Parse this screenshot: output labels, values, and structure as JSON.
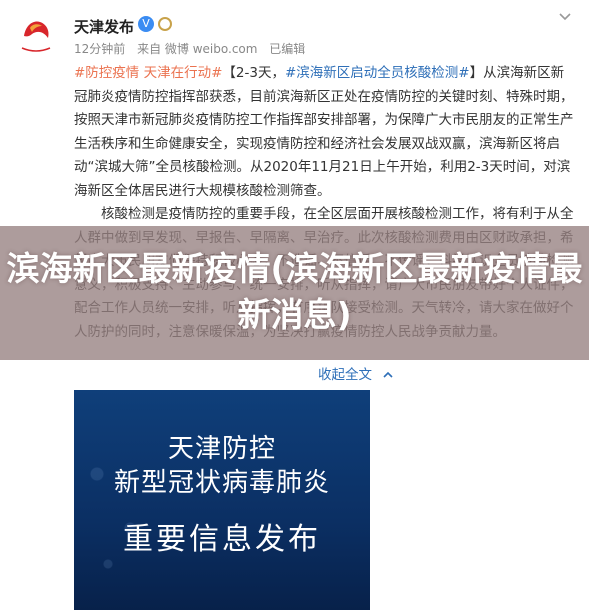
{
  "post": {
    "username": "天津发布",
    "verified": "V",
    "meta": {
      "time": "12分钟前",
      "source": "来自 微博 weibo.com",
      "edited": "已编辑"
    },
    "tag": "#防控疫情 天津在行动#",
    "hashtag": "#滨海新区启动全员核酸检测#",
    "para1_head": "【2-3天，",
    "para1_tail": "】从滨海新区新冠肺炎疫情防控指挥部获悉，目前滨海新区正处在疫情防控的关键时刻、特殊时期，按照天津市新冠肺炎疫情防控工作指挥部安排部署，为保障广大市民朋友的正常生产生活秩序和生命健康安全，实现疫情防控和经济社会发展双战双赢，滨海新区将启动“滨城大筛”全员核酸检测。从2020年11月21日上午开始，利用2-3天时间，对滨海新区全体居民进行大规模核酸检测筛查。",
    "para2": "核酸检测是疫情防控的重要手段，在全区层面开展核酸检测工作，将有利于从全人群中做到早发现、早报告、早隔离、早治疗。此次核酸检测费用由区财政承担，希望广大市民朋友们保持积极心态，不造谣、不信谣、不传谣，科学认识全员核酸检测意义，积极支持、主动参与、统一安排，听从指挥，请广大市民朋友带好个人证件，配合工作人员统一安排，听从指挥，有序排队接受检测。天气转冷，请大家在做好个人防护的同时，注意保暖保温，为坚决打赢疫情防控人民战争贡献力量。",
    "collapse": "收起全文",
    "collapse_icon": "chevron-up-icon"
  },
  "overlay": {
    "title": "滨海新区最新疫情(滨海新区最新疫情最新消息)"
  },
  "image": {
    "line1": "天津防控",
    "line2": "新型冠状病毒肺炎",
    "line3": "重要信息发布"
  },
  "colors": {
    "link": "#2e6fb8",
    "tag": "#eb7350",
    "overlay": "#968080",
    "image_bg": "#0b2f63"
  }
}
